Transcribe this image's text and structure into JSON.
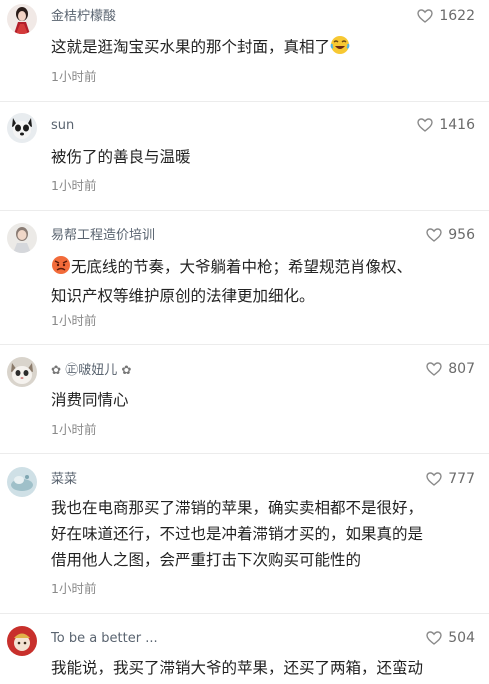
{
  "comments": [
    {
      "username": "金桔柠檬酸",
      "likes": "1622",
      "text": "这就是逛淘宝买水果的那个封面，真相了",
      "emoji_after": "laughing-tears",
      "time": "1小时前"
    },
    {
      "username": "sun",
      "likes": "1416",
      "text": "被伤了的善良与温暖",
      "time": "1小时前"
    },
    {
      "username": "易帮工程造价培训",
      "likes": "956",
      "emoji_before": "angry-face",
      "text_line1": "无底线的节奏，大爷躺着中枪；希望规范肖像权、",
      "text_line2": "知识产权等维护原创的法律更加细化。",
      "time": "1小时前"
    },
    {
      "username_prefix": "✿",
      "username": "㊣啵妞儿",
      "username_suffix": "✿",
      "likes": "807",
      "text": "消费同情心",
      "time": "1小时前"
    },
    {
      "username": "菜菜",
      "likes": "777",
      "text_line1": "我也在电商那买了滞销的苹果，确实卖相都不是很好，",
      "text_line2": "好在味道还行，不过也是冲着滞销才买的，如果真的是",
      "text_line3": "借用他人之图，会严重打击下次购买可能性的",
      "time": "1小时前"
    },
    {
      "username": "To be a better ...",
      "likes": "504",
      "text": "我能说，我买了滞销大爷的苹果，还买了两箱，还蛮动"
    }
  ],
  "icons": {
    "like": "heart-outline-icon"
  },
  "colors": {
    "username": "#5a6470",
    "time": "#8a8a8a",
    "text": "#222222",
    "like": "#6b6b6b"
  }
}
